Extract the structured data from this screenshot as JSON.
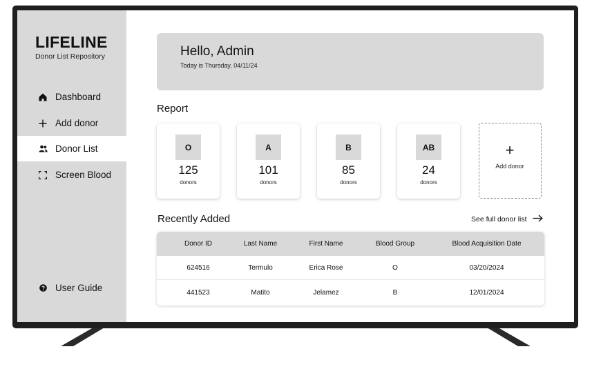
{
  "app": {
    "name": "LIFELINE",
    "subtitle": "Donor List Repository"
  },
  "sidebar": {
    "items": [
      {
        "label": "Dashboard",
        "icon": "home-icon",
        "active": false
      },
      {
        "label": "Add donor",
        "icon": "plus-icon",
        "active": false
      },
      {
        "label": "Donor List",
        "icon": "users-icon",
        "active": true
      },
      {
        "label": "Screen Blood",
        "icon": "scan-icon",
        "active": false
      }
    ],
    "footer": {
      "label": "User Guide",
      "icon": "help-icon"
    }
  },
  "header": {
    "greeting": "Hello, Admin",
    "date_text": "Today is Thursday, 04/11/24"
  },
  "report": {
    "title": "Report",
    "cards": [
      {
        "group": "O",
        "count": "125",
        "unit": "donors"
      },
      {
        "group": "A",
        "count": "101",
        "unit": "donors"
      },
      {
        "group": "B",
        "count": "85",
        "unit": "donors"
      },
      {
        "group": "AB",
        "count": "24",
        "unit": "donors"
      }
    ],
    "add_card": {
      "icon": "+",
      "label": "Add donor"
    }
  },
  "recent": {
    "title": "Recently Added",
    "see_all_label": "See full donor list",
    "columns": [
      "Donor ID",
      "Last Name",
      "First Name",
      "Blood Group",
      "Blood Acquisition Date"
    ],
    "rows": [
      [
        "624516",
        "Termulo",
        "Erica Rose",
        "O",
        "03/20/2024"
      ],
      [
        "441523",
        "Matito",
        "Jelamez",
        "B",
        "12/01/2024"
      ]
    ]
  },
  "colors": {
    "panel_gray": "#d9d9d9",
    "bezel": "#1f1f1f",
    "text": "#111111"
  }
}
